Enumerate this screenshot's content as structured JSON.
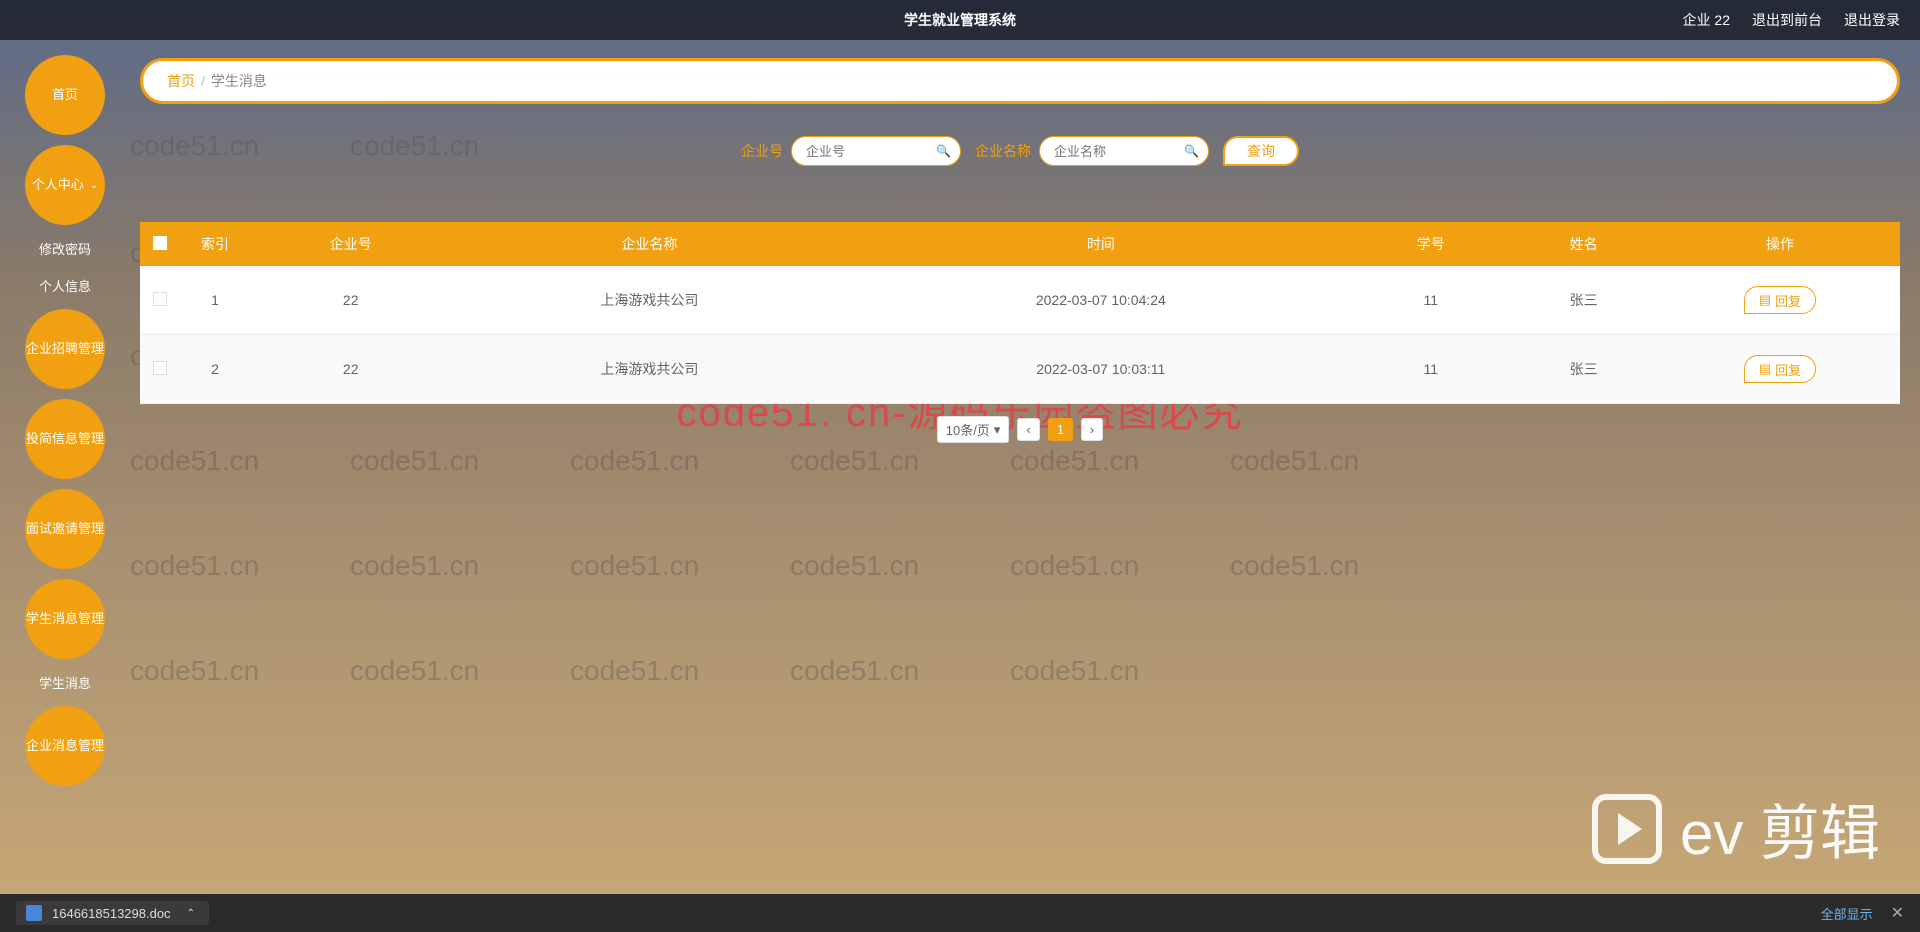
{
  "header": {
    "title": "学生就业管理系统",
    "user": "企业 22",
    "to_front": "退出到前台",
    "logout": "退出登录"
  },
  "sidebar": {
    "home": "首页",
    "personal_center": "个人中心",
    "change_pwd": "修改密码",
    "personal_info": "个人信息",
    "recruit_mgmt": "企业招聘管理",
    "resume_mgmt": "投简信息管理",
    "interview_mgmt": "面试邀请管理",
    "student_msg_mgmt": "学生消息管理",
    "student_msg": "学生消息",
    "enterprise_msg_mgmt": "企业消息管理"
  },
  "breadcrumb": {
    "home": "首页",
    "current": "学生消息"
  },
  "search": {
    "field1_label": "企业号",
    "field1_placeholder": "企业号",
    "field2_label": "企业名称",
    "field2_placeholder": "企业名称",
    "button": "查询"
  },
  "table": {
    "headers": {
      "index": "索引",
      "enterprise_no": "企业号",
      "enterprise_name": "企业名称",
      "time": "时间",
      "student_no": "学号",
      "name": "姓名",
      "action": "操作"
    },
    "rows": [
      {
        "index": "1",
        "enterprise_no": "22",
        "enterprise_name": "上海游戏共公司",
        "time": "2022-03-07 10:04:24",
        "student_no": "11",
        "name": "张三",
        "action": "回复"
      },
      {
        "index": "2",
        "enterprise_no": "22",
        "enterprise_name": "上海游戏共公司",
        "time": "2022-03-07 10:03:11",
        "student_no": "11",
        "name": "张三",
        "action": "回复"
      }
    ]
  },
  "pagination": {
    "page_size": "10条/页",
    "page1": "1"
  },
  "download": {
    "filename": "1646618513298.doc",
    "show_all": "全部显示"
  },
  "watermarks": {
    "small": "code51.cn",
    "big": "code51. cn-源码乐园盗图必究",
    "ev": "ev 剪辑"
  }
}
